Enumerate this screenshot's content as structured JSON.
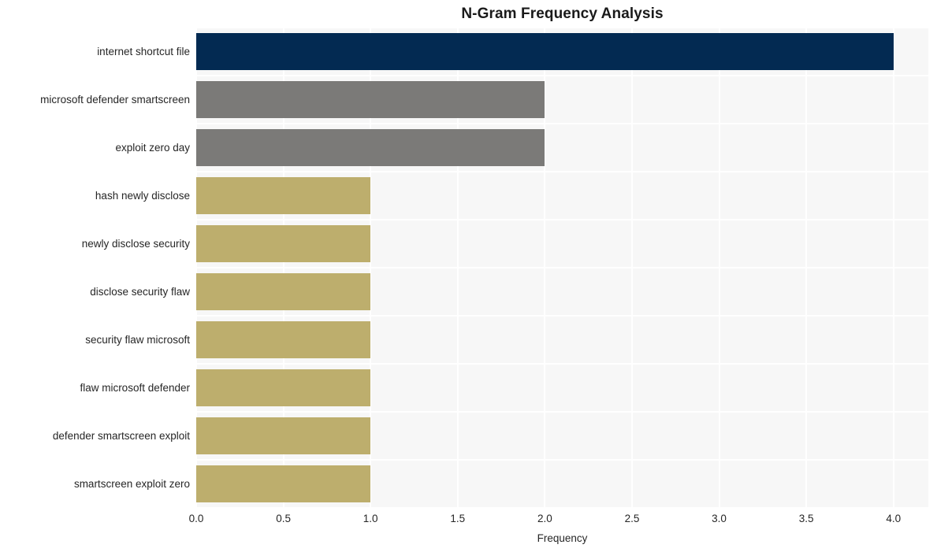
{
  "chart_data": {
    "type": "bar",
    "orientation": "horizontal",
    "title": "N-Gram Frequency Analysis",
    "xlabel": "Frequency",
    "ylabel": "",
    "categories": [
      "internet shortcut file",
      "microsoft defender smartscreen",
      "exploit zero day",
      "hash newly disclose",
      "newly disclose security",
      "disclose security flaw",
      "security flaw microsoft",
      "flaw microsoft defender",
      "defender smartscreen exploit",
      "smartscreen exploit zero"
    ],
    "values": [
      4,
      2,
      2,
      1,
      1,
      1,
      1,
      1,
      1,
      1
    ],
    "bar_colors": [
      "#032a52",
      "#7b7a78",
      "#7b7a78",
      "#bdae6d",
      "#bdae6d",
      "#bdae6d",
      "#bdae6d",
      "#bdae6d",
      "#bdae6d",
      "#bdae6d"
    ],
    "xlim": [
      0,
      4.2
    ],
    "xticks": [
      0,
      0.5,
      1,
      1.5,
      2,
      2.5,
      3,
      3.5,
      4
    ],
    "xtick_labels": [
      "0.0",
      "0.5",
      "1.0",
      "1.5",
      "2.0",
      "2.5",
      "3.0",
      "3.5",
      "4.0"
    ],
    "grid": true,
    "grid_color": "#ffffff",
    "legend": null,
    "plot_background": "#f7f7f7",
    "figure_background": "#ffffff",
    "text_color": "#262626",
    "title_color": "#1a1a1a"
  }
}
